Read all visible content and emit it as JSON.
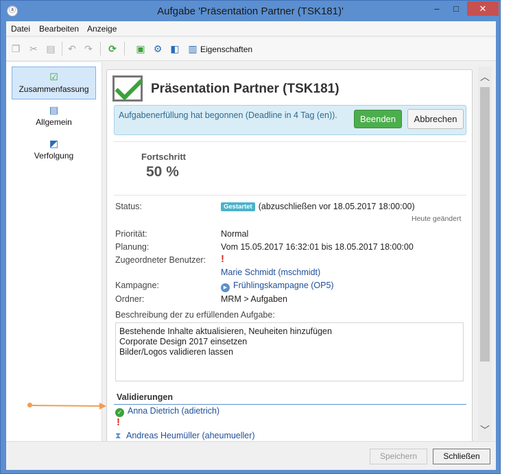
{
  "window": {
    "title": "Aufgabe 'Präsentation Partner (TSK181)'",
    "app_icon": "app-icon",
    "buttons": {
      "minimize": "–",
      "maximize": "□",
      "close": "✕"
    }
  },
  "menubar": {
    "items": [
      "Datei",
      "Bearbeiten",
      "Anzeige"
    ]
  },
  "toolbar": {
    "icons": [
      "copy-icon",
      "cut-icon",
      "paste-icon",
      "undo-icon",
      "redo-icon",
      "refresh-icon",
      "calculator-icon",
      "settings-gear-icon",
      "bookmark-icon",
      "properties-icon"
    ],
    "properties_label": "Eigenschaften"
  },
  "sidebar": {
    "items": [
      {
        "label": "Zusammenfassung",
        "icon": "checkbox-icon",
        "active": true
      },
      {
        "label": "Allgemein",
        "icon": "clipboard-icon",
        "active": false
      },
      {
        "label": "Verfolgung",
        "icon": "tracking-icon",
        "active": false
      }
    ]
  },
  "header": {
    "title": "Präsentation Partner (TSK181)",
    "banner_text": "Aufgabenerfüllung hat begonnen (Deadline in 4 Tag (en)).",
    "finish_label": "Beenden",
    "cancel_label": "Abbrechen"
  },
  "progress": {
    "label": "Fortschritt",
    "value": "50 %",
    "percent": 50
  },
  "fields": {
    "status_label": "Status:",
    "status_badge": "Gestartet",
    "status_text": "(abzuschließen vor 18.05.2017 18:00:00)",
    "status_note": "Heute geändert",
    "priority_label": "Priorität:",
    "priority_value": "Normal",
    "planning_label": "Planung:",
    "planning_value": "Vom 15.05.2017 16:32:01 bis 18.05.2017 18:00:00",
    "assignee_label": "Zugeordneter Benutzer:",
    "assignee_value": "Marie Schmidt (mschmidt)",
    "campaign_label": "Kampagne:",
    "campaign_value": "Frühlingskampagne (OP5)",
    "folder_label": "Ordner:",
    "folder_value": "MRM > Aufgaben",
    "description_label": "Beschreibung der zu erfüllenden Aufgabe:",
    "description_lines": [
      "Bestehende Inhalte aktualisieren, Neuheiten hinzufügen",
      "Corporate Design 2017 einsetzen",
      "Bilder/Logos validieren lassen"
    ]
  },
  "validations": {
    "title": "Validierungen",
    "items": [
      {
        "name": "Anna Dietrich (adietrich)",
        "state": "approved"
      },
      {
        "name": "Andreas Heumüller (aheumueller)",
        "state": "pending"
      }
    ]
  },
  "footer": {
    "save_label": "Speichern",
    "close_label": "Schließen"
  },
  "colors": {
    "window_frame": "#5b8fd0",
    "accent_green": "#4cae4c",
    "banner_bg": "#d9edf7",
    "arrow": "#f29d50",
    "link": "#1f4f99"
  }
}
